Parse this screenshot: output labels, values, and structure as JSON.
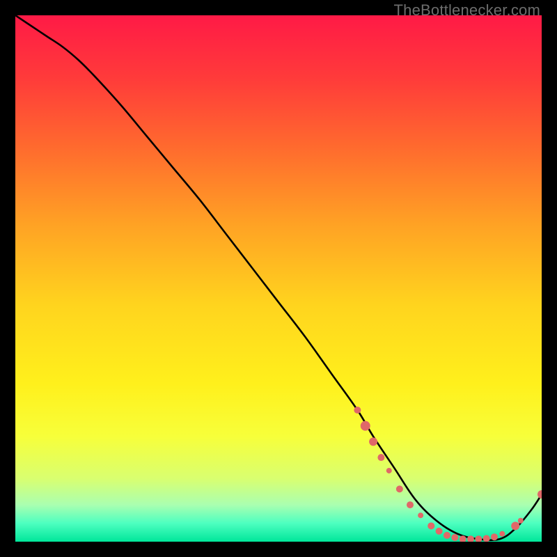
{
  "watermark": "TheBottlenecker.com",
  "chart_data": {
    "type": "line",
    "title": "",
    "xlabel": "",
    "ylabel": "",
    "xlim": [
      0,
      100
    ],
    "ylim": [
      0,
      100
    ],
    "grid": false,
    "background_gradient": [
      {
        "pos": 0.0,
        "color": "#ff1a46"
      },
      {
        "pos": 0.12,
        "color": "#ff3b3a"
      },
      {
        "pos": 0.25,
        "color": "#ff6a2e"
      },
      {
        "pos": 0.4,
        "color": "#ffa324"
      },
      {
        "pos": 0.55,
        "color": "#ffd41e"
      },
      {
        "pos": 0.7,
        "color": "#fff01c"
      },
      {
        "pos": 0.8,
        "color": "#f7ff3a"
      },
      {
        "pos": 0.88,
        "color": "#d9ff70"
      },
      {
        "pos": 0.93,
        "color": "#aaffb0"
      },
      {
        "pos": 0.965,
        "color": "#4dffc0"
      },
      {
        "pos": 1.0,
        "color": "#00e69a"
      }
    ],
    "series": [
      {
        "name": "bottleneck-curve",
        "color": "#000000",
        "x": [
          0,
          3,
          6,
          9,
          12,
          15,
          20,
          25,
          30,
          35,
          40,
          45,
          50,
          55,
          60,
          65,
          68,
          72,
          76,
          80,
          84,
          88,
          92,
          95,
          98,
          100
        ],
        "y": [
          100,
          98,
          96,
          94,
          91.5,
          88.5,
          83,
          77,
          71,
          65,
          58.5,
          52,
          45.5,
          39,
          32,
          25,
          20,
          14,
          8,
          4,
          1.5,
          0.5,
          0.5,
          2.5,
          6,
          9
        ]
      }
    ],
    "markers": {
      "name": "highlight-points",
      "color": "#e06868",
      "points": [
        {
          "x": 65,
          "y": 25,
          "r": 5
        },
        {
          "x": 66.5,
          "y": 22,
          "r": 7
        },
        {
          "x": 68,
          "y": 19,
          "r": 6
        },
        {
          "x": 69.5,
          "y": 16,
          "r": 5
        },
        {
          "x": 71,
          "y": 13.5,
          "r": 4
        },
        {
          "x": 73,
          "y": 10,
          "r": 5
        },
        {
          "x": 75,
          "y": 7,
          "r": 5
        },
        {
          "x": 77,
          "y": 5,
          "r": 4
        },
        {
          "x": 79,
          "y": 3,
          "r": 5
        },
        {
          "x": 80.5,
          "y": 2,
          "r": 5
        },
        {
          "x": 82,
          "y": 1.2,
          "r": 5
        },
        {
          "x": 83.5,
          "y": 0.8,
          "r": 5
        },
        {
          "x": 85,
          "y": 0.5,
          "r": 5
        },
        {
          "x": 86.5,
          "y": 0.5,
          "r": 5
        },
        {
          "x": 88,
          "y": 0.5,
          "r": 5
        },
        {
          "x": 89.5,
          "y": 0.6,
          "r": 5
        },
        {
          "x": 91,
          "y": 0.9,
          "r": 5
        },
        {
          "x": 92.5,
          "y": 1.5,
          "r": 4
        },
        {
          "x": 95,
          "y": 3,
          "r": 6
        },
        {
          "x": 96,
          "y": 4,
          "r": 4
        },
        {
          "x": 100,
          "y": 9,
          "r": 6
        }
      ]
    }
  }
}
